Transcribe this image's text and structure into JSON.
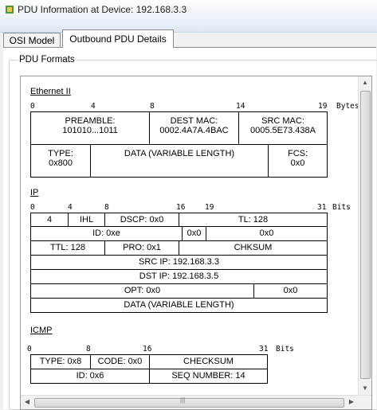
{
  "window": {
    "title": "PDU Information at Device: 192.168.3.3"
  },
  "tabs": [
    {
      "label": "OSI Model"
    },
    {
      "label": "Outbound PDU Details"
    }
  ],
  "group": {
    "label": "PDU Formats"
  },
  "ethernet": {
    "title": "Ethernet II",
    "ruler": {
      "t0": "0",
      "t1": "4",
      "t2": "8",
      "t3": "14",
      "t4": "19",
      "unit": "Bytes"
    },
    "preamble": {
      "label": "PREAMBLE:",
      "value": "101010...1011"
    },
    "dest_mac": {
      "label": "DEST MAC:",
      "value": "0002.4A7A.4BAC"
    },
    "src_mac": {
      "label": "SRC MAC:",
      "value": "0005.5E73.438A"
    },
    "type": {
      "label": "TYPE:",
      "value": "0x800"
    },
    "data": {
      "label": "DATA (VARIABLE LENGTH)"
    },
    "fcs": {
      "label": "FCS:",
      "value": "0x0"
    }
  },
  "ip": {
    "title": "IP",
    "ruler": {
      "t0": "0",
      "t1": "4",
      "t2": "8",
      "t3": "16",
      "t4": "19",
      "t5": "31",
      "unit": "Bits"
    },
    "version": "4",
    "ihl": "IHL",
    "dscp": "DSCP: 0x0",
    "tl": "TL: 128",
    "id": "ID: 0xe",
    "flag1": "0x0",
    "frag": "0x0",
    "ttl": "TTL: 128",
    "pro": "PRO: 0x1",
    "chksum": "CHKSUM",
    "src_ip": "SRC IP: 192.168.3.3",
    "dst_ip": "DST IP: 192.168.3.5",
    "opt": "OPT: 0x0",
    "pad": "0x0",
    "data": "DATA (VARIABLE LENGTH)"
  },
  "icmp": {
    "title": "ICMP",
    "ruler": {
      "t0": "0",
      "t1": "8",
      "t2": "16",
      "t3": "31",
      "unit": "Bits"
    },
    "type": "TYPE: 0x8",
    "code": "CODE: 0x0",
    "checksum": "CHECKSUM",
    "id": "ID: 0x6",
    "seq": "SEQ NUMBER: 14"
  }
}
